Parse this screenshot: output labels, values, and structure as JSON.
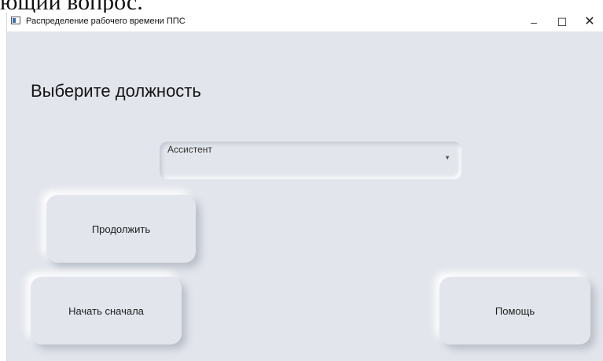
{
  "cropped_text": "ющий вопрос.",
  "window": {
    "title": "Распределение рабочего времени ППС",
    "controls": {
      "minimize": "–",
      "maximize": "☐",
      "close": "✕"
    }
  },
  "main": {
    "heading": "Выберите должность",
    "position_select": {
      "selected": "Ассистент",
      "arrow": "▼"
    },
    "buttons": {
      "continue": "Продолжить",
      "restart": "Начать сначала",
      "help": "Помощь"
    }
  },
  "colors": {
    "background": "#e2e5ec"
  }
}
